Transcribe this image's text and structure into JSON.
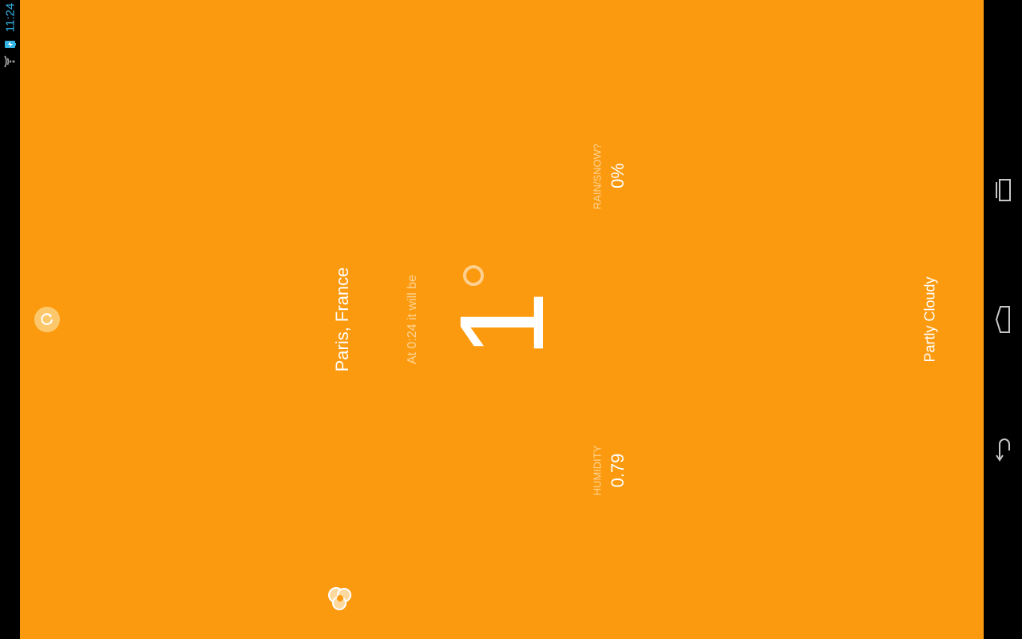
{
  "status_bar": {
    "time": "11:24",
    "icons": [
      "battery-charging-icon",
      "wifi-icon"
    ],
    "clock_color": "#33b5e5"
  },
  "app": {
    "background_color": "#fc9a0f",
    "location": "Paris, France",
    "forecast_time": "At 0:24 it will be",
    "temperature": "1",
    "precipitation": {
      "label": "RAIN/SNOW?",
      "value": "0%"
    },
    "humidity": {
      "label": "HUMIDITY",
      "value": "0.79"
    },
    "condition": "Partly Cloudy",
    "icons": [
      "refresh-icon",
      "weather-logo-icon"
    ]
  },
  "nav_bar": {
    "buttons": [
      "recent-apps-icon",
      "home-icon",
      "back-icon"
    ]
  }
}
